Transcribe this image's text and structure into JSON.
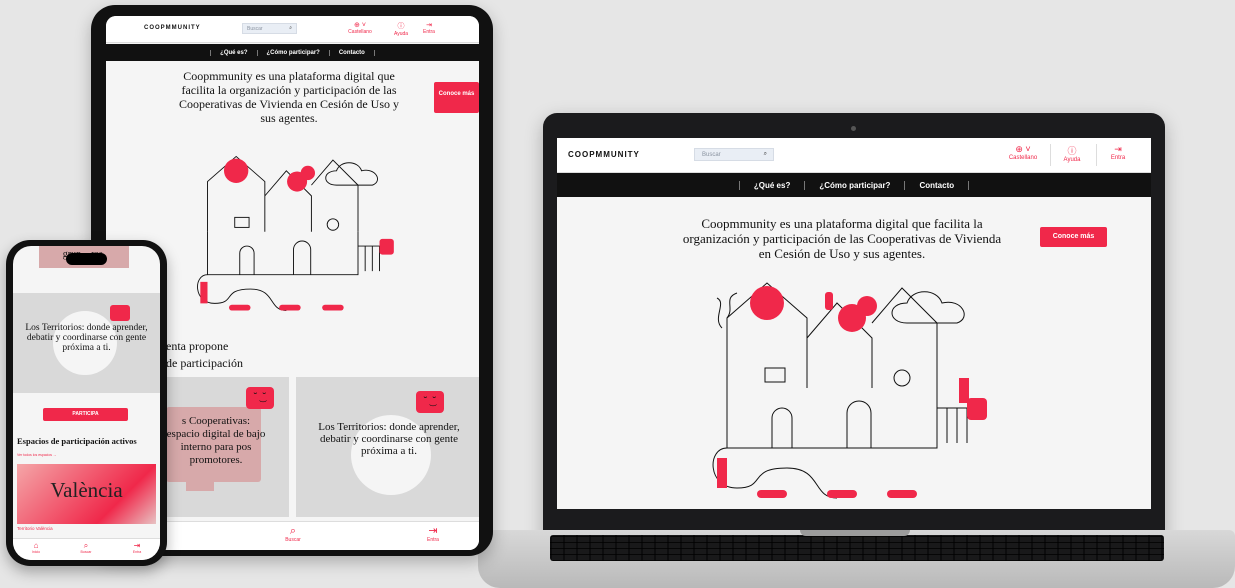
{
  "brand": {
    "logo": "COOPMMUNITY",
    "accent": "#f0284a",
    "dark": "#111111"
  },
  "laptop": {
    "header": {
      "search_placeholder": "Buscar",
      "lang_label": "Castellano",
      "help_label": "Ayuda",
      "enter_label": "Entra"
    },
    "nav": [
      "¿Qué es?",
      "¿Cómo participar?",
      "Contacto"
    ],
    "hero_text": "Coopmmunity es una plataforma digital que facilita la organización y participación de las Cooperativas de Vivienda en Cesión de Uso y sus agentes.",
    "cta": "Conoce más"
  },
  "tablet": {
    "header": {
      "search_placeholder": "Buscar",
      "lang_label": "Castellano",
      "help_label": "Ayuda",
      "enter_label": "Entra"
    },
    "nav": [
      "¿Qué es?",
      "¿Cómo participar?",
      "Contacto"
    ],
    "hero_text": "Coopmmunity es una plataforma digital que facilita la organización y participación de las Cooperativas de Vivienda en Cesión de Uso y sus agentes.",
    "cta": "Conoce más",
    "section_line1": "enta propone",
    "section_line2": "de participación",
    "card1_text": "s Cooperativas: espacio digital de bajo interno para pos promotores.",
    "card2_text": "Los Territorios: donde aprender, debatir y coordinarse con gente próxima a ti.",
    "bottom_nav": {
      "search": "Buscar",
      "enter": "Entra"
    }
  },
  "phone": {
    "top_text": "grup... res.",
    "card_text": "Los Territorios: donde aprender, debatir y coordinarse con gente próxima a ti.",
    "button": "PARTICIPA",
    "section_title": "Espacios de participación activos",
    "link": "Ver todos los espacios →",
    "image_title": "València",
    "image_caption": "Territorio València",
    "bottom_nav": [
      "Inicio",
      "Buscar",
      "Entra"
    ]
  }
}
